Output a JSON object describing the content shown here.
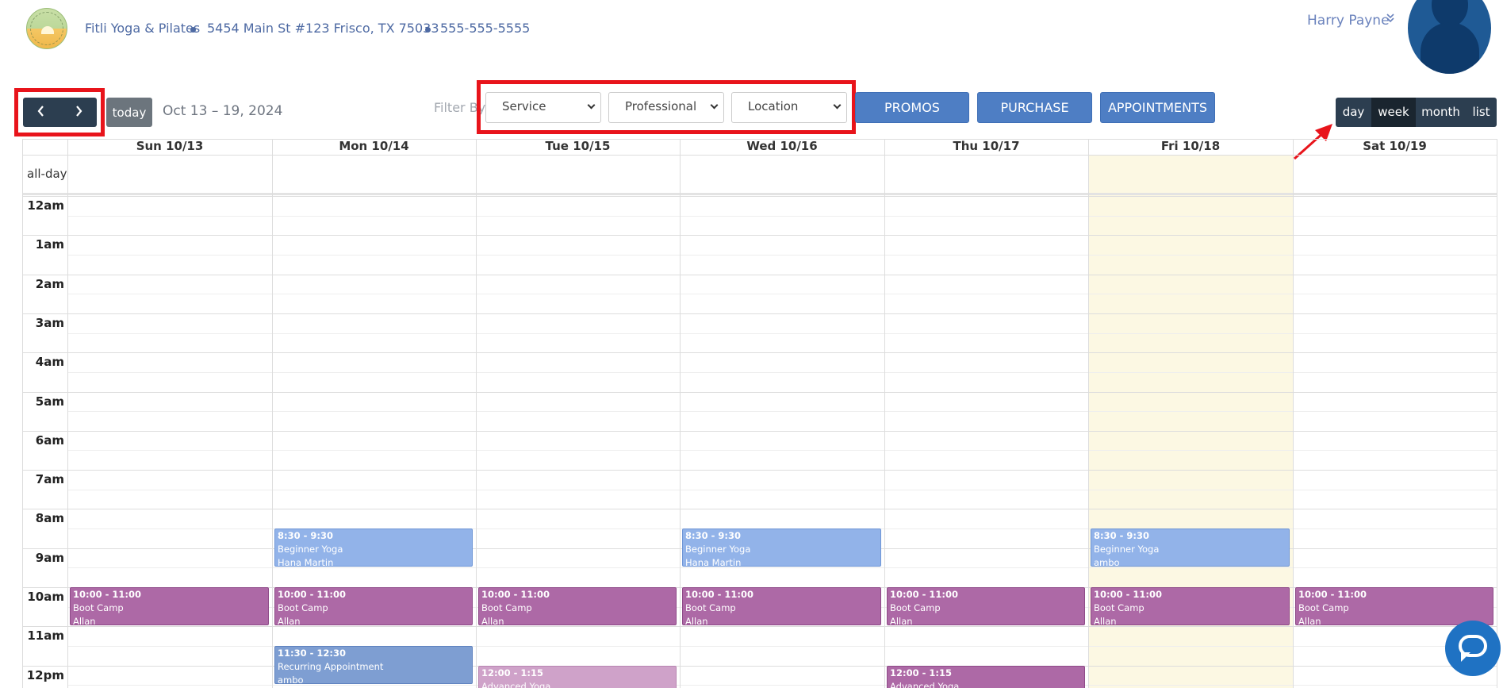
{
  "business": {
    "name": "Fitli Yoga & Pilates",
    "address": "5454 Main St #123 Frisco, TX 75033",
    "phone": "555-555-5555"
  },
  "user": {
    "name": "Harry Payne"
  },
  "toolbar": {
    "prev": "‹",
    "next": "›",
    "today": "today",
    "range": "Oct 13 – 19, 2024",
    "filter_label": "Filter By",
    "service": "Service",
    "professional": "Professional",
    "location": "Location",
    "promos": "PROMOS",
    "purchase": "PURCHASE",
    "appointments": "APPOINTMENTS"
  },
  "views": [
    "day",
    "week",
    "month",
    "list"
  ],
  "active_view": "week",
  "days": [
    "Sun 10/13",
    "Mon 10/14",
    "Tue 10/15",
    "Wed 10/16",
    "Thu 10/17",
    "Fri 10/18",
    "Sat 10/19"
  ],
  "today_day_index": 5,
  "allday_label": "all-day",
  "hours": [
    "12am",
    "1am",
    "2am",
    "3am",
    "4am",
    "5am",
    "6am",
    "7am",
    "8am",
    "9am",
    "10am",
    "11am",
    "12pm"
  ],
  "events": [
    {
      "day": 1,
      "time": "8:30 - 9:30",
      "title": "Beginner Yoga",
      "who": "Hana Martin",
      "start": 8.5,
      "end": 9.5,
      "color": "blue"
    },
    {
      "day": 3,
      "time": "8:30 - 9:30",
      "title": "Beginner Yoga",
      "who": "Hana Martin",
      "start": 8.5,
      "end": 9.5,
      "color": "blue"
    },
    {
      "day": 5,
      "time": "8:30 - 9:30",
      "title": "Beginner Yoga",
      "who": "ambo",
      "start": 8.5,
      "end": 9.5,
      "color": "blue"
    },
    {
      "day": 0,
      "time": "10:00 - 11:00",
      "title": "Boot Camp",
      "who": "Allan",
      "start": 10,
      "end": 11,
      "color": "purple"
    },
    {
      "day": 1,
      "time": "10:00 - 11:00",
      "title": "Boot Camp",
      "who": "Allan",
      "start": 10,
      "end": 11,
      "color": "purple"
    },
    {
      "day": 2,
      "time": "10:00 - 11:00",
      "title": "Boot Camp",
      "who": "Allan",
      "start": 10,
      "end": 11,
      "color": "purple"
    },
    {
      "day": 3,
      "time": "10:00 - 11:00",
      "title": "Boot Camp",
      "who": "Allan",
      "start": 10,
      "end": 11,
      "color": "purple"
    },
    {
      "day": 4,
      "time": "10:00 - 11:00",
      "title": "Boot Camp",
      "who": "Allan",
      "start": 10,
      "end": 11,
      "color": "purple"
    },
    {
      "day": 5,
      "time": "10:00 - 11:00",
      "title": "Boot Camp",
      "who": "Allan",
      "start": 10,
      "end": 11,
      "color": "purple"
    },
    {
      "day": 6,
      "time": "10:00 - 11:00",
      "title": "Boot Camp",
      "who": "Allan",
      "start": 10,
      "end": 11,
      "color": "purple"
    },
    {
      "day": 1,
      "time": "11:30 - 12:30",
      "title": "Recurring Appointment",
      "who": "ambo",
      "start": 11.5,
      "end": 12.5,
      "color": "slate"
    },
    {
      "day": 2,
      "time": "12:00 - 1:15",
      "title": "Advanced Yoga",
      "who": "",
      "start": 12,
      "end": 13.25,
      "color": "light"
    },
    {
      "day": 4,
      "time": "12:00 - 1:15",
      "title": "Advanced Yoga",
      "who": "",
      "start": 12,
      "end": 13.25,
      "color": "purple"
    }
  ]
}
